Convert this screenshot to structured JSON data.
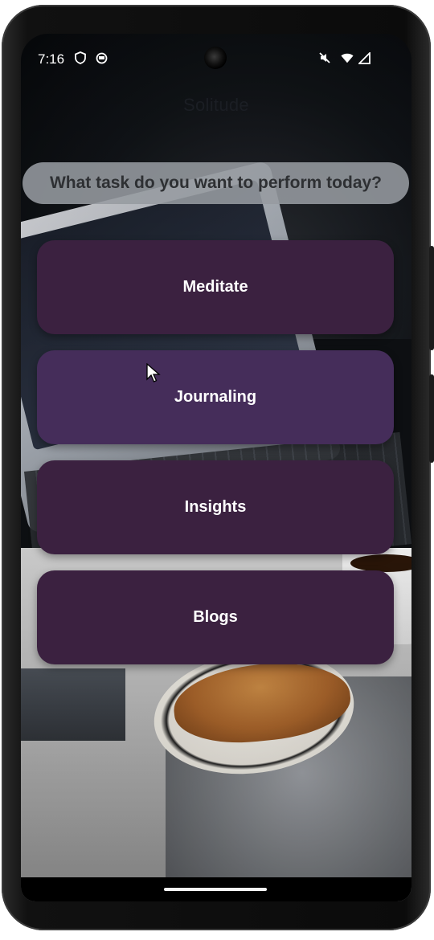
{
  "status_bar": {
    "time": "7:16",
    "left_icons": [
      "shield-icon",
      "vpn-icon"
    ],
    "right_icons": [
      "mute-icon",
      "wifi-icon",
      "signal-icon"
    ]
  },
  "app": {
    "title": "Solitude",
    "prompt": "What task do you want to perform today?",
    "buttons": [
      {
        "label": "Meditate",
        "color": "#3b2140"
      },
      {
        "label": "Journaling",
        "color": "#452d5a"
      },
      {
        "label": "Insights",
        "color": "#3b2140"
      },
      {
        "label": "Blogs",
        "color": "#3b2140"
      }
    ]
  },
  "theme": {
    "button_primary": "#3b2140",
    "button_hover": "#452d5a",
    "prompt_bg": "#969ba0"
  }
}
